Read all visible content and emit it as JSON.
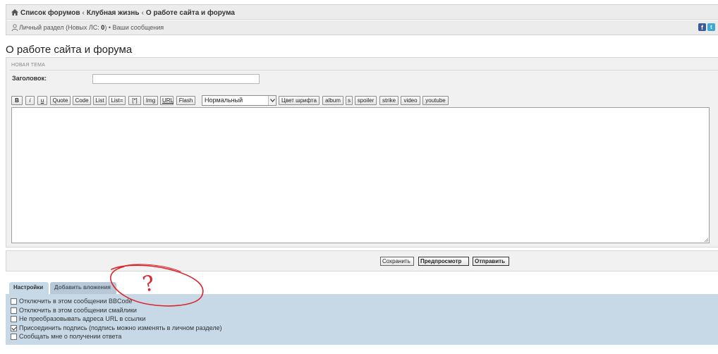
{
  "nav": {
    "breadcrumbs": [
      "Список форумов",
      "Клубная жизнь",
      "О работе сайта и форума"
    ],
    "user_section_label": "Личный раздел (Новых ЛС: ",
    "new_pm_count": "0",
    "user_section_close": ")",
    "separator": " • ",
    "your_posts_label": "Ваши сообщения",
    "facebook_letter": "f",
    "twitter_letter": "t"
  },
  "page": {
    "title": "О работе сайта и форума"
  },
  "post_form": {
    "header": "НОВАЯ ТЕМА",
    "subject_label": "Заголовок:",
    "subject_value": "",
    "message_value": "",
    "bbcode_buttons": [
      "B",
      "i",
      "u",
      "Quote",
      "Code",
      "List",
      "List=",
      "[*]",
      "Img",
      "URL",
      "Flash"
    ],
    "font_size_selected": "Нормальный",
    "extra_buttons": [
      "Цвет шрифта",
      "album",
      "s",
      "spoiler",
      "strike",
      "video",
      "youtube"
    ]
  },
  "actions": {
    "save_label": "Сохранить",
    "preview_label": "Предпросмотр",
    "submit_label": "Отправить"
  },
  "tabs": [
    {
      "label": "Настройки",
      "active": true
    },
    {
      "label": "Добавить вложения",
      "active": false
    }
  ],
  "options": [
    {
      "label": "Отключить в этом сообщении BBCode",
      "checked": false
    },
    {
      "label": "Отключить в этом сообщении смайлики",
      "checked": false
    },
    {
      "label": "Не преобразовывать адреса URL в ссылки",
      "checked": false
    },
    {
      "label": "Присоединить подпись (подпись можно изменять в личном разделе)",
      "checked": true
    },
    {
      "label": "Сообщать мне о получении ответа",
      "checked": false
    }
  ],
  "annotation": {
    "text": "?",
    "color": "#d9262b"
  },
  "colors": {
    "navbar_bg": "#ececec",
    "panel_bg": "#f1f1f1",
    "tab_panel_bg": "#c7d9e6",
    "annotation_red": "#d9262b"
  }
}
